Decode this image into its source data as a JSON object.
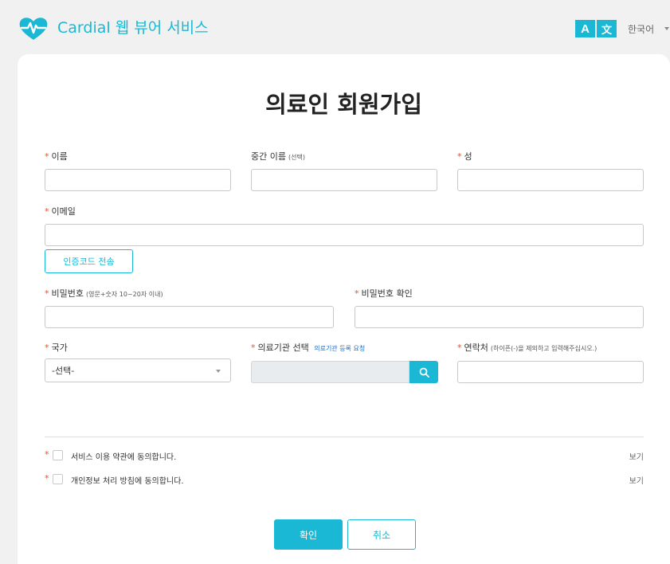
{
  "header": {
    "app_title": "Cardial 웹 뷰어 서비스",
    "lang_icon_a": "A",
    "lang_icon_b": "文",
    "language": "한국어",
    "brand_color": "#1ab8d4"
  },
  "page": {
    "title": "의료인 회원가입"
  },
  "required_mark": "*",
  "fields": {
    "first_name": {
      "label": "이름",
      "value": ""
    },
    "middle_name": {
      "label": "중간 이름",
      "hint": "(선택)",
      "value": ""
    },
    "last_name": {
      "label": "성",
      "value": ""
    },
    "email": {
      "label": "이메일",
      "value": ""
    },
    "password": {
      "label": "비밀번호",
      "hint": "(영문+숫자 10~20자 이내)",
      "value": ""
    },
    "password_confirm": {
      "label": "비밀번호 확인",
      "value": ""
    },
    "country": {
      "label": "국가",
      "selected": "-선택-"
    },
    "institution": {
      "label": "의료기관 선택",
      "link": "의료기관 등록 요청",
      "value": ""
    },
    "phone": {
      "label": "연락처",
      "hint": "(하이픈(-)을 제외하고 입력해주십시오.)",
      "value": ""
    }
  },
  "buttons": {
    "send_code": "인증코드 전송",
    "confirm": "확인",
    "cancel": "취소"
  },
  "agreements": [
    {
      "text": "서비스 이용 약관에 동의합니다.",
      "view": "보기",
      "checked": false
    },
    {
      "text": "개인정보 처리 방침에 동의합니다.",
      "view": "보기",
      "checked": false
    }
  ],
  "icons": {
    "logo": "heart-pulse-icon",
    "language": "translate-icon",
    "search": "search-icon",
    "dropdown": "chevron-down-icon"
  },
  "colors": {
    "accent": "#1ab8d4",
    "required": "#e0523a",
    "link": "#1e6fc8"
  }
}
